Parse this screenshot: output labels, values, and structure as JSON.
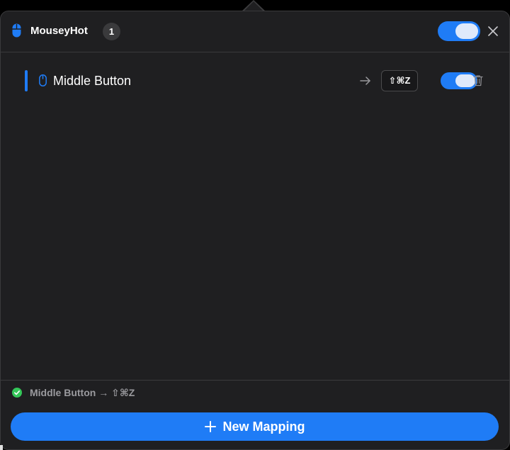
{
  "header": {
    "app_title": "MouseyHot",
    "mapping_count": "1",
    "icon": "mouse-icon",
    "enabled": true
  },
  "mappings": [
    {
      "icon": "mouse-icon",
      "button_label": "Middle Button",
      "shortcut": "⇧⌘Z",
      "enabled": true
    }
  ],
  "status": {
    "icon": "checkmark-circle-icon",
    "text": "Middle Button  →  ⇧⌘Z"
  },
  "footer": {
    "new_mapping_label": "New Mapping",
    "icon": "plus-icon"
  },
  "colors": {
    "accent": "#1f7cf6",
    "panel_bg": "#1f1f21",
    "status_ok": "#34c759"
  }
}
